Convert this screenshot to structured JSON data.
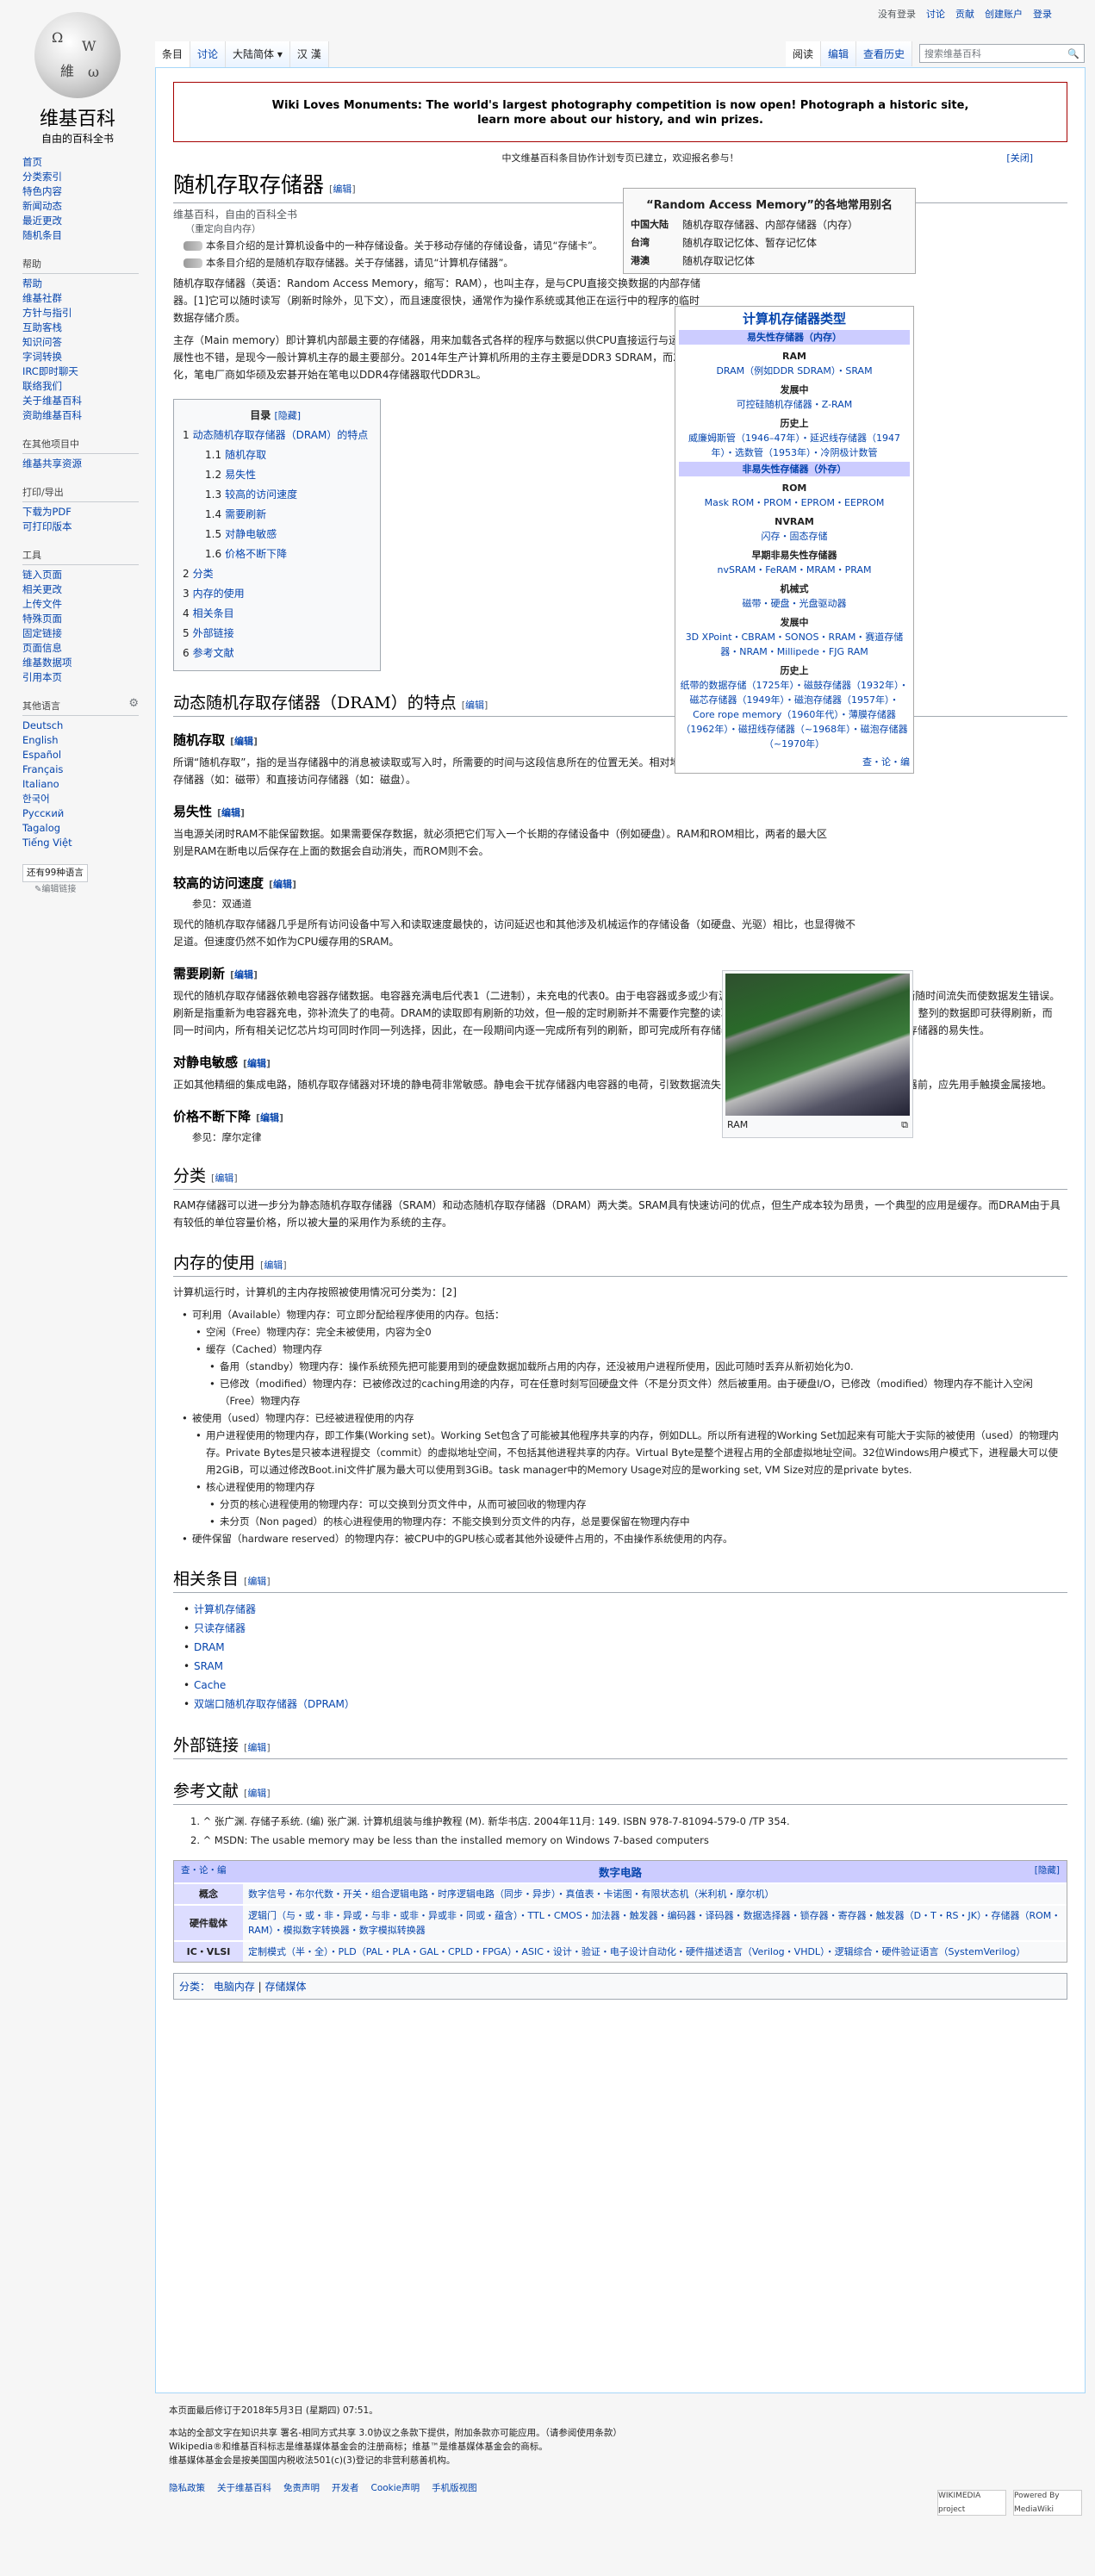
{
  "personal": {
    "not_logged": "没有登录",
    "talk": "讨论",
    "contrib": "贡献",
    "create": "创建账户",
    "login": "登录"
  },
  "logo": {
    "title": "维基百科",
    "subtitle": "自由的百科全书"
  },
  "sidebar": {
    "nav": [
      "首页",
      "分类索引",
      "特色内容",
      "新闻动态",
      "最近更改",
      "随机条目"
    ],
    "help_h": "帮助",
    "help": [
      "帮助",
      "维基社群",
      "方针与指引",
      "互助客栈",
      "知识问答",
      "字词转换",
      "IRC即时聊天",
      "联络我们",
      "关于维基百科",
      "资助维基百科"
    ],
    "other_h": "在其他项目中",
    "other": [
      "维基共享资源"
    ],
    "print_h": "打印/导出",
    "print": [
      "下载为PDF",
      "可打印版本"
    ],
    "tools_h": "工具",
    "tools": [
      "链入页面",
      "相关更改",
      "上传文件",
      "特殊页面",
      "固定链接",
      "页面信息",
      "维基数据项",
      "引用本页"
    ],
    "lang_h": "其他语言",
    "langs": [
      "Deutsch",
      "English",
      "Español",
      "Français",
      "Italiano",
      "한국어",
      "Русский",
      "Tagalog",
      "Tiếng Việt"
    ],
    "more_langs": "还有99种语言",
    "edit_links": "编辑链接"
  },
  "tabs": {
    "article": "条目",
    "talk": "讨论",
    "variant": "大陆简体",
    "vr1": "汉",
    "vr2": "漢",
    "read": "阅读",
    "edit": "编辑",
    "history": "查看历史",
    "search_ph": "搜索维基百科"
  },
  "notice": {
    "line1": "Wiki Loves Monuments: The world's largest photography competition is now open! Photograph a historic site,",
    "line2": "learn more about our history, and win prizes."
  },
  "notice2": {
    "text": "中文维基百科条目协作计划专页已建立，欢迎报名参与！",
    "close": "[关闭]"
  },
  "page": {
    "title": "随机存取存储器",
    "edit": "编辑",
    "tagline": "维基百科，自由的百科全书",
    "redirect": "（重定向自内存）",
    "hat1": "本条目介绍的是计算机设备中的一种存储设备。关于移动存储的存储设备，请见“存储卡”。",
    "hat2": "本条目介绍的是随机存取存储器。关于存储器，请见“计算机存储器”。",
    "p1": "随机存取存储器（英语：Random Access Memory，缩写：RAM），也叫主存，是与CPU直接交换数据的内部存储器。[1]它可以随时读写（刷新时除外，见下文），而且速度很快，通常作为操作系统或其他正在运行中的程序的临时数据存储介质。",
    "p2": "主存（Main memory）即计算机内部最主要的存储器，用来加载各式各样的程序与数据以供CPU直接运行与运用。由于DRAM的性价比很高，且扩展性也不错，是现今一般计算机主存的最主要部分。2014年生产计算机所用的主存主要是DDR3 SDRAM，而2016年开始DDR4 SDRAM逐渐普及化，笔电厂商如华硕及宏碁开始在笔电以DDR4存储器取代DDR3L。"
  },
  "terms": {
    "title": "“Random Access Memory”的各地常用别名",
    "rows": [
      [
        "中国大陆",
        "随机存取存储器、内部存储器（内存）"
      ],
      [
        "台湾",
        "随机存取记忆体、暂存记忆体"
      ],
      [
        "港澳",
        "随机存取记忆体"
      ]
    ]
  },
  "navbox": {
    "title": "计算机存储器类型",
    "bar1": "易失性存储器（内存）",
    "h_ram": "RAM",
    "ram": "DRAM（例如DDR SDRAM）・SRAM",
    "h_dev": "发展中",
    "dev": "可控硅随机存储器・Z-RAM",
    "h_hist": "历史上",
    "hist": "威廉姆斯管（1946–47年）・延迟线存储器（1947年）・选数管（1953年）・冷阴极计数管",
    "bar2": "非易失性存储器（外存）",
    "h_rom": "ROM",
    "rom": "Mask ROM・PROM・EPROM・EEPROM",
    "h_nvram": "NVRAM",
    "nvram": "闪存・固态存储",
    "h_early": "早期非易失性存储器",
    "early": "nvSRAM・FeRAM・MRAM・PRAM",
    "h_mech": "机械式",
    "mech": "磁带・硬盘・光盘驱动器",
    "h_dev2": "发展中",
    "dev2": "3D XPoint・CBRAM・SONOS・RRAM・赛道存储器・NRAM・Millipede・FJG RAM",
    "h_hist2": "历史上",
    "hist2": "纸带的数据存储（1725年）・磁鼓存储器（1932年）・磁芯存储器（1949年）・磁泡存储器（1957年）・Core rope memory（1960年代）・薄膜存储器（1962年）・磁扭线存储器（~1968年）・磁泡存储器（~1970年）",
    "foot": "查・论・编"
  },
  "toc": {
    "title": "目录",
    "hide": "[隐藏]",
    "items": [
      {
        "n": "1",
        "t": "动态随机存取存储器（DRAM）的特点",
        "lvl": 1
      },
      {
        "n": "1.1",
        "t": "随机存取",
        "lvl": 2
      },
      {
        "n": "1.2",
        "t": "易失性",
        "lvl": 2
      },
      {
        "n": "1.3",
        "t": "较高的访问速度",
        "lvl": 2
      },
      {
        "n": "1.4",
        "t": "需要刷新",
        "lvl": 2
      },
      {
        "n": "1.5",
        "t": "对静电敏感",
        "lvl": 2
      },
      {
        "n": "1.6",
        "t": "价格不断下降",
        "lvl": 2
      },
      {
        "n": "2",
        "t": "分类",
        "lvl": 1
      },
      {
        "n": "3",
        "t": "内存的使用",
        "lvl": 1
      },
      {
        "n": "4",
        "t": "相关条目",
        "lvl": 1
      },
      {
        "n": "5",
        "t": "外部链接",
        "lvl": 1
      },
      {
        "n": "6",
        "t": "参考文献",
        "lvl": 1
      }
    ]
  },
  "s1": {
    "h": "动态随机存取存储器（DRAM）的特点",
    "a_h": "随机存取",
    "a_p": "所谓“随机存取”，指的是当存储器中的消息被读取或写入时，所需要的时间与这段信息所在的位置无关。相对地，串行访问存储器包括顺序访问存储器（如：磁带）和直接访问存储器（如：磁盘）。",
    "b_h": "易失性",
    "b_p": "当电源关闭时RAM不能保留数据。如果需要保存数据，就必须把它们写入一个长期的存储设备中（例如硬盘）。RAM和ROM相比，两者的最大区别是RAM在断电以后保存在上面的数据会自动消失，而ROM则不会。",
    "c_h": "较高的访问速度",
    "c_see": "参见：双通道",
    "c_p": "现代的随机存取存储器几乎是所有访问设备中写入和读取速度最快的，访问延迟也和其他涉及机械运作的存储设备（如硬盘、光驱）相比，也显得微不足道。但速度仍然不如作为CPU缓存用的SRAM。",
    "d_h": "需要刷新",
    "d_p": "现代的随机存取存储器依赖电容器存储数据。电容器充满电后代表1（二进制），未充电的代表0。由于电容器或多或少有漏电的情形，若不作特别处理，电荷会渐渐随时间流失而使数据发生错误。刷新是指重新为电容器充电，弥补流失了的电荷。DRAM的读取即有刷新的功效，但一般的定时刷新并不需要作完整的读取，只需作该芯片的一个列（Row）选择，整列的数据即可获得刷新，而同一时间内，所有相关记忆芯片均可同时作同一列选择，因此，在一段期间内逐一完成所有列的刷新，即可完成所有存储器的刷新。需要刷新正好解释了随机存取存储器的易失性。",
    "e_h": "对静电敏感",
    "e_p": "正如其他精细的集成电路，随机存取存储器对环境的静电荷非常敏感。静电会干扰存储器内电容器的电荷，引致数据流失，甚至烧坏电路。故此触碰随机存取存储器前，应先用手触摸金属接地。",
    "f_h": "价格不断下降",
    "f_see": "参见：摩尔定律"
  },
  "thumb": {
    "cap": "RAM"
  },
  "s2": {
    "h": "分类",
    "p": "RAM存储器可以进一步分为静态随机存取存储器（SRAM）和动态随机存取存储器（DRAM）两大类。SRAM具有快速访问的优点，但生产成本较为昂贵，一个典型的应用是缓存。而DRAM由于具有较低的单位容量价格，所以被大量的采用作为系统的主存。"
  },
  "s3": {
    "h": "内存的使用",
    "intro": "计算机运行时，计算机的主内存按照被使用情况可分类为：[2]",
    "items": [
      {
        "l": 1,
        "t": "可利用（Available）物理内存：可立即分配给程序使用的内存。包括："
      },
      {
        "l": 2,
        "t": "空闲（Free）物理内存：完全未被使用，内容为全0"
      },
      {
        "l": 2,
        "t": "缓存（Cached）物理内存"
      },
      {
        "l": 3,
        "t": "备用（standby）物理内存：操作系统预先把可能要用到的硬盘数据加载所占用的内存，还没被用户进程所使用，因此可随时丢弃从新初始化为0."
      },
      {
        "l": 3,
        "t": "已修改（modified）物理内存：已被修改过的caching用途的内存，可在任意时刻写回硬盘文件（不是分页文件）然后被重用。由于硬盘I/O，已修改（modified）物理内存不能计入空闲（Free）物理内存"
      },
      {
        "l": 1,
        "t": "被使用（used）物理内存：已经被进程使用的内存"
      },
      {
        "l": 2,
        "t": "用户进程使用的物理内存，即工作集(Working set)。Working Set包含了可能被其他程序共享的内存，例如DLL。所以所有进程的Working Set加起来有可能大于实际的被使用（used）的物理内存。Private Bytes是只被本进程提交（commit）的虚拟地址空间，不包括其他进程共享的内存。Virtual Byte是整个进程占用的全部虚拟地址空间。32位Windows用户模式下，进程最大可以使用2GiB，可以通过修改Boot.ini文件扩展为最大可以使用到3GiB。task manager中的Memory Usage对应的是working set, VM Size对应的是private bytes."
      },
      {
        "l": 2,
        "t": "核心进程使用的物理内存"
      },
      {
        "l": 3,
        "t": "分页的核心进程使用的物理内存：可以交换到分页文件中，从而可被回收的物理内存"
      },
      {
        "l": 3,
        "t": "未分页（Non paged）的核心进程使用的物理内存：不能交换到分页文件的内存，总是要保留在物理内存中"
      },
      {
        "l": 1,
        "t": "硬件保留（hardware reserved）的物理内存：被CPU中的GPU核心或者其他外设硬件占用的，不由操作系统使用的内存。"
      }
    ]
  },
  "s4": {
    "h": "相关条目",
    "items": [
      "计算机存储器",
      "只读存储器",
      "DRAM",
      "SRAM",
      "Cache",
      "双端口随机存取存储器（DPRAM）"
    ]
  },
  "s5": {
    "h": "外部链接"
  },
  "s6": {
    "h": "参考文献",
    "refs": [
      "1. ^ 张广渊. 存储子系统. (编) 张广渊. 计算机组装与维护教程 (M). 新华书店. 2004年11月: 149. ISBN 978-7-81094-579-0 /TP 354.",
      "2. ^ MSDN: The usable memory may be less than the installed memory on Windows 7-based computers"
    ]
  },
  "dnav": {
    "left": "查・论・编",
    "title": "数字电路",
    "hide": "[隐藏]",
    "rows": [
      [
        "概念",
        "数字信号・布尔代数・开关・组合逻辑电路・时序逻辑电路（同步・异步）・真值表・卡诺图・有限状态机（米利机・摩尔机）"
      ],
      [
        "硬件载体",
        "逻辑门（与・或・非・异或・与非・或非・异或非・同或・蕴含）・TTL・CMOS・加法器・触发器・编码器・译码器・数据选择器・锁存器・寄存器・触发器（D・T・RS・JK）・存储器（ROM・RAM）・模拟数字转换器・数字模拟转换器"
      ],
      [
        "IC・VLSI",
        "定制模式（半・全）・PLD（PAL・PLA・GAL・CPLD・FPGA）・ASIC・设计・验证・电子设计自动化・硬件描述语言（Verilog・VHDL）・逻辑综合・硬件验证语言（SystemVerilog）"
      ]
    ]
  },
  "cats": {
    "label": "分类：",
    "items": [
      "电脑内存",
      "存储媒体"
    ]
  },
  "footer": {
    "modified": "本页面最后修订于2018年5月3日 (星期四) 07:51。",
    "license": "本站的全部文字在知识共享 署名-相同方式共享 3.0协议之条款下提供，附加条款亦可能应用。（请参阅使用条款）",
    "trademark": "Wikipedia®和维基百科标志是维基媒体基金会的注册商标；维基™是维基媒体基金会的商标。",
    "foundation": "维基媒体基金会是按美国国内税收法501(c)(3)登记的非营利慈善机构。",
    "links": [
      "隐私政策",
      "关于维基百科",
      "免责声明",
      "开发者",
      "Cookie声明",
      "手机版视图"
    ],
    "badge1": "WIKIMEDIA project",
    "badge2": "Powered By MediaWiki"
  }
}
